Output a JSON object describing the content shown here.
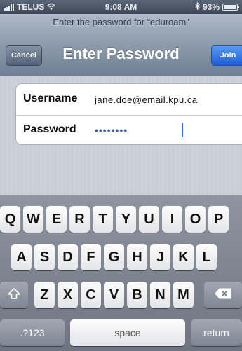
{
  "status_bar": {
    "carrier": "TELUS",
    "time": "9:08 AM",
    "battery": "93%",
    "battery_level": 0.93,
    "icons": [
      "signal-icon",
      "wifi-icon",
      "bluetooth-icon",
      "battery-icon"
    ]
  },
  "nav": {
    "prompt": "Enter the password for “eduroam”",
    "title": "Enter Password",
    "cancel_label": "Cancel",
    "join_label": "Join"
  },
  "form": {
    "username_label": "Username",
    "username_value": "jane.doe@email.kpu.ca",
    "password_label": "Password",
    "password_value": "••••••••"
  },
  "keyboard": {
    "row1": [
      "Q",
      "W",
      "E",
      "R",
      "T",
      "Y",
      "U",
      "I",
      "O",
      "P"
    ],
    "row2": [
      "A",
      "S",
      "D",
      "F",
      "G",
      "H",
      "J",
      "K",
      "L"
    ],
    "row3": [
      "Z",
      "X",
      "C",
      "V",
      "B",
      "N",
      "M"
    ],
    "shift_icon": "shift-icon",
    "delete_icon": "delete-icon",
    "numbers_label": ".?123",
    "space_label": "space",
    "return_label": "return"
  },
  "colors": {
    "join_button": "#1b5fd9",
    "nav_bar": "#8f9dae",
    "caret": "#2f6fe0"
  }
}
